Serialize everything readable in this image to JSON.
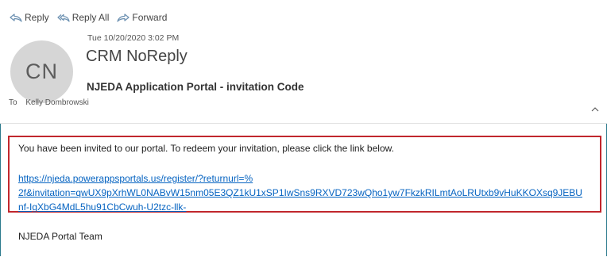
{
  "toolbar": {
    "reply": "Reply",
    "reply_all": "Reply All",
    "forward": "Forward"
  },
  "message": {
    "date": "Tue 10/20/2020 3:02 PM",
    "avatar_initials": "CN",
    "sender": "CRM NoReply",
    "subject": "NJEDA Application Portal - invitation Code",
    "to_label": "To",
    "to": "Kelly Dombrowski"
  },
  "body": {
    "intro": "You have been invited to our portal. To redeem your invitation, please click the link below.",
    "link_line1": "https://njeda.powerappsportals.us/register/?returnurl=%",
    "link_line2": "2f&invitation=qwUX9pXrhWL0NABvW15nm05E3QZ1kU1xSP1IwSns9RXVD723wQho1yw7FkzkRILmtAoLRUtxb9vHuKKOXsq9JEBU",
    "link_line3": "nf-IgXbG4MdL5hu91CbCwuh-U2tzc-llk-",
    "signoff": "NJEDA Portal Team"
  },
  "colors": {
    "link": "#0563c1",
    "highlight_border": "#c1272d",
    "frame_border": "#2b7a8c",
    "avatar_bg": "#d6d6d6"
  }
}
